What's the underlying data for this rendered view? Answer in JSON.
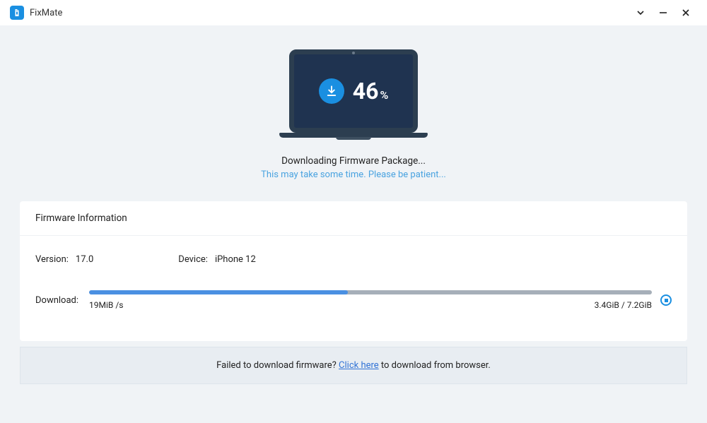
{
  "app": {
    "title": "FixMate"
  },
  "progress": {
    "percent": "46",
    "percent_symbol": "%",
    "status": "Downloading Firmware Package...",
    "subtext": "This may take some time. Please be patient..."
  },
  "panel": {
    "title": "Firmware Information",
    "version_label": "Version:",
    "version_value": "17.0",
    "device_label": "Device:",
    "device_value": "iPhone 12",
    "download_label": "Download:",
    "speed": "19MiB /s",
    "size": "3.4GiB / 7.2GiB",
    "progress_percent": 46
  },
  "footer": {
    "prefix": "Failed to download firmware? ",
    "link": "Click here",
    "suffix": " to download from browser."
  },
  "colors": {
    "accent": "#1a8fe1",
    "screen_bg": "#1f3350",
    "progress_fill": "#4a90e2"
  }
}
